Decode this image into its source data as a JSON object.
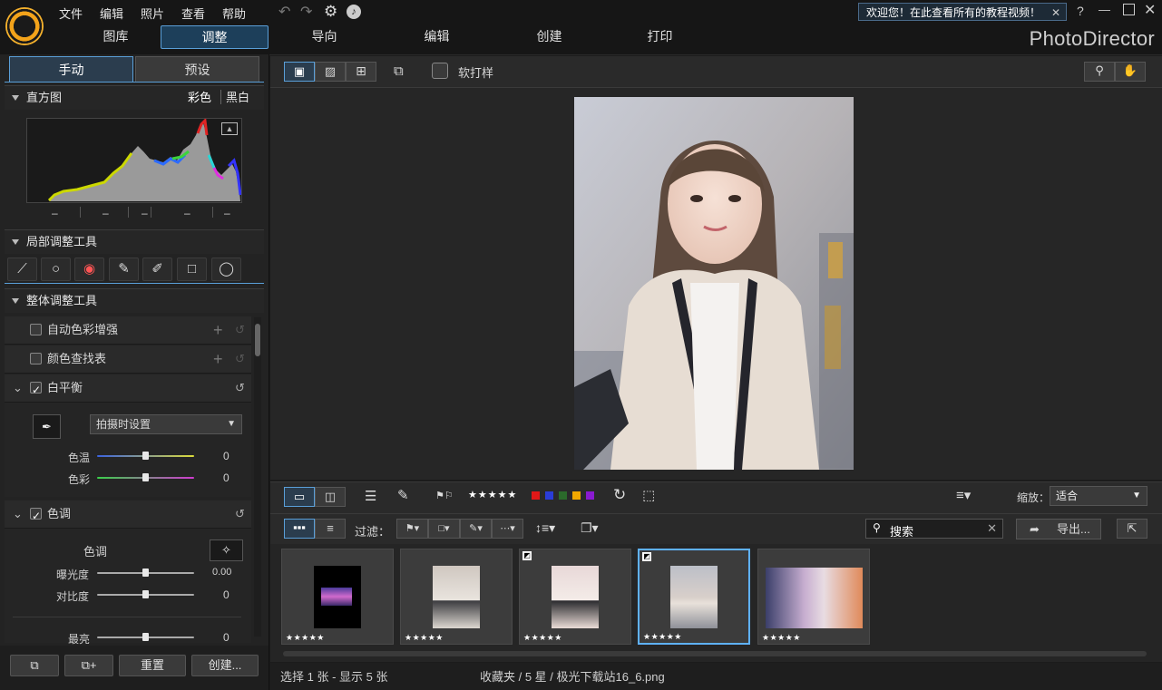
{
  "app": {
    "brand": "PhotoDirector",
    "welcome": "欢迎您！在此查看所有的教程视频！",
    "help": "?"
  },
  "menu": [
    "文件",
    "编辑",
    "照片",
    "查看",
    "帮助"
  ],
  "nav_tabs": [
    "图库",
    "调整",
    "导向",
    "编辑",
    "创建",
    "打印"
  ],
  "active_tab": "调整",
  "left_tabs": {
    "manual": "手动",
    "preset": "预设"
  },
  "histogram": {
    "title": "直方图",
    "color": "彩色",
    "bw": "黑白",
    "values": [
      "–",
      "–",
      "–",
      "–",
      "–"
    ]
  },
  "local_tools": {
    "title": "局部调整工具"
  },
  "global_tools": {
    "title": "整体调整工具",
    "auto_color": "自动色彩增强",
    "color_lut": "颜色查找表",
    "white_balance": "白平衡",
    "wb_preset": "拍摄时设置",
    "temp_label": "色温",
    "temp_value": "0",
    "tint_label": "色彩",
    "tint_value": "0",
    "tone": "色调",
    "tone_sub": "色调",
    "exposure_label": "曝光度",
    "exposure_value": "0.00",
    "contrast_label": "对比度",
    "contrast_value": "0",
    "highlight_label": "最亮",
    "highlight_value": "0"
  },
  "bottom_buttons": {
    "reset": "重置",
    "create": "创建..."
  },
  "toolbar": {
    "softproof": "软打样"
  },
  "filter": {
    "label": "过滤：",
    "stars": "★★★★★",
    "zoom_label": "缩放：",
    "zoom_value": "适合",
    "search_placeholder": "搜索",
    "export": "导出..."
  },
  "thumbnails": [
    {
      "stars": "★★★★★"
    },
    {
      "stars": "★★★★★"
    },
    {
      "stars": "★★★★★"
    },
    {
      "stars": "★★★★★"
    },
    {
      "stars": "★★★★★"
    }
  ],
  "status": {
    "left": "选择 1 张 - 显示 5 张",
    "right": "收藏夹 / 5 星 / 极光下载站16_6.png"
  },
  "colors": {
    "accent": "#5fb2ff",
    "active_tab_bg": "#1d3f5a"
  }
}
